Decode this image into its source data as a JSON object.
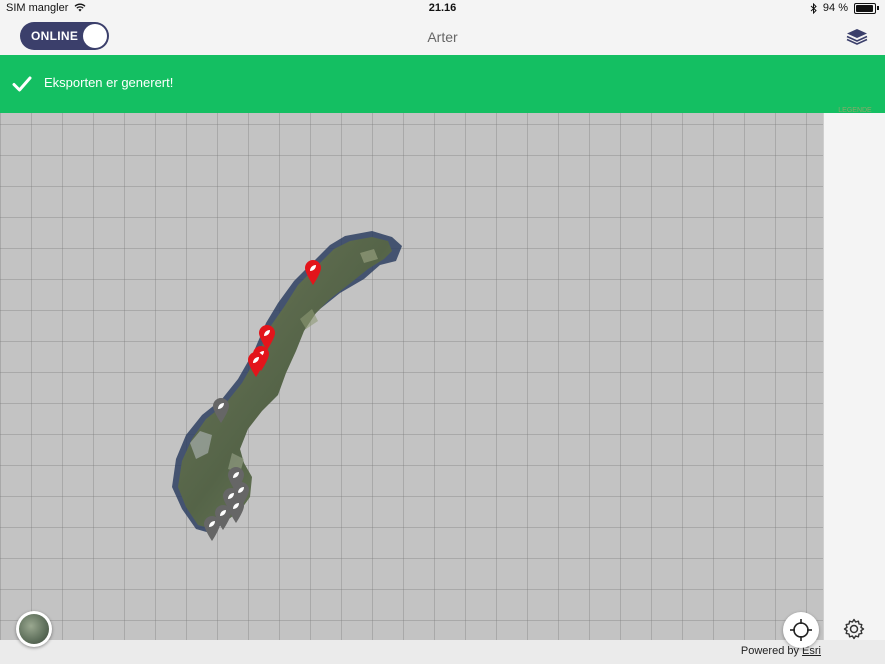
{
  "status_bar": {
    "carrier": "SIM mangler",
    "time": "21.16",
    "battery": "94 %"
  },
  "nav": {
    "toggle_label": "ONLINE",
    "title": "Arter"
  },
  "banner": {
    "message": "Eksporten er generert!",
    "color": "#14bf62"
  },
  "sidebar": {
    "legend_label": "LEGENDE"
  },
  "footer": {
    "powered_by": "Powered by",
    "provider": "Esri"
  },
  "map": {
    "markers_red_count": 4,
    "markers_gray_count": 7,
    "colors": {
      "red_marker": "#e3141b",
      "gray_marker": "#666666"
    }
  }
}
